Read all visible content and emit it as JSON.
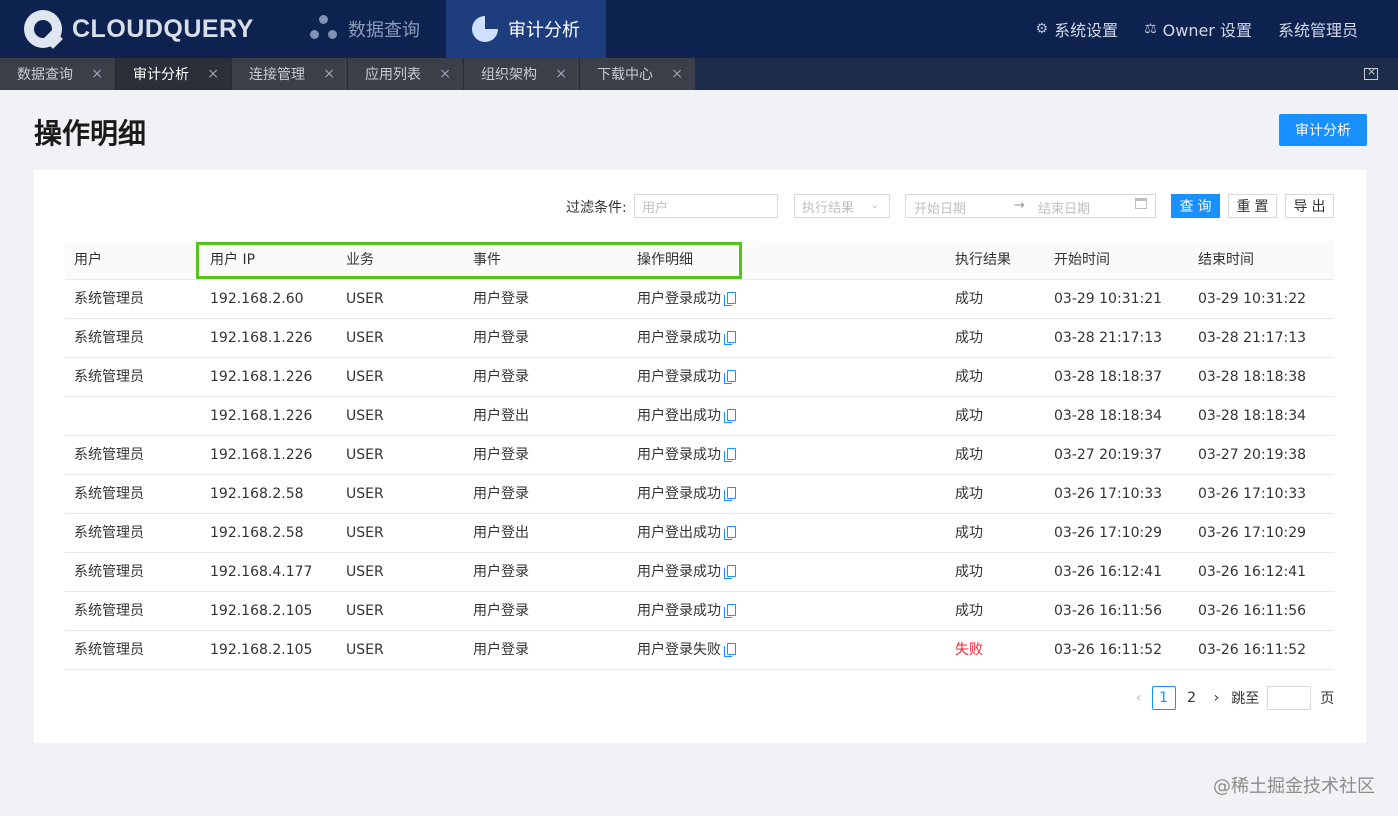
{
  "brand": {
    "logo_text": "CLOUDQUERY"
  },
  "top_nav": {
    "tabs": [
      {
        "label": "数据查询",
        "icon": "network-icon",
        "active": false
      },
      {
        "label": "审计分析",
        "icon": "pie-chart-icon",
        "active": true
      }
    ],
    "right": [
      {
        "label": "系统设置",
        "icon": "users-gear-icon"
      },
      {
        "label": "Owner 设置",
        "icon": "database-icon"
      },
      {
        "label": "系统管理员",
        "icon": ""
      }
    ]
  },
  "tab_strip": {
    "tabs": [
      {
        "label": "数据查询",
        "active": false
      },
      {
        "label": "审计分析",
        "active": true
      },
      {
        "label": "连接管理",
        "active": false
      },
      {
        "label": "应用列表",
        "active": false
      },
      {
        "label": "组织架构",
        "active": false
      },
      {
        "label": "下载中心",
        "active": false
      }
    ],
    "close_glyph": "×"
  },
  "page": {
    "title": "操作明细",
    "action_button": "审计分析"
  },
  "filters": {
    "label": "过滤条件:",
    "user_placeholder": "用户",
    "result_placeholder": "执行结果",
    "start_date_placeholder": "开始日期",
    "range_arrow": "→",
    "end_date_placeholder": "结束日期",
    "query_button": "查询",
    "reset_button": "重置",
    "export_button": "导出"
  },
  "table": {
    "columns": [
      "用户",
      "用户 IP",
      "业务",
      "事件",
      "操作明细",
      "执行结果",
      "开始时间",
      "结束时间"
    ],
    "rows": [
      {
        "user": "系统管理员",
        "ip": "192.168.2.60",
        "biz": "USER",
        "event": "用户登录",
        "detail": "用户登录成功",
        "result": "成功",
        "start": "03-29 10:31:21",
        "end": "03-29 10:31:22"
      },
      {
        "user": "系统管理员",
        "ip": "192.168.1.226",
        "biz": "USER",
        "event": "用户登录",
        "detail": "用户登录成功",
        "result": "成功",
        "start": "03-28 21:17:13",
        "end": "03-28 21:17:13"
      },
      {
        "user": "系统管理员",
        "ip": "192.168.1.226",
        "biz": "USER",
        "event": "用户登录",
        "detail": "用户登录成功",
        "result": "成功",
        "start": "03-28 18:18:37",
        "end": "03-28 18:18:38"
      },
      {
        "user": "",
        "ip": "192.168.1.226",
        "biz": "USER",
        "event": "用户登出",
        "detail": "用户登出成功",
        "result": "成功",
        "start": "03-28 18:18:34",
        "end": "03-28 18:18:34"
      },
      {
        "user": "系统管理员",
        "ip": "192.168.1.226",
        "biz": "USER",
        "event": "用户登录",
        "detail": "用户登录成功",
        "result": "成功",
        "start": "03-27 20:19:37",
        "end": "03-27 20:19:38"
      },
      {
        "user": "系统管理员",
        "ip": "192.168.2.58",
        "biz": "USER",
        "event": "用户登录",
        "detail": "用户登录成功",
        "result": "成功",
        "start": "03-26 17:10:33",
        "end": "03-26 17:10:33"
      },
      {
        "user": "系统管理员",
        "ip": "192.168.2.58",
        "biz": "USER",
        "event": "用户登出",
        "detail": "用户登出成功",
        "result": "成功",
        "start": "03-26 17:10:29",
        "end": "03-26 17:10:29"
      },
      {
        "user": "系统管理员",
        "ip": "192.168.4.177",
        "biz": "USER",
        "event": "用户登录",
        "detail": "用户登录成功",
        "result": "成功",
        "start": "03-26 16:12:41",
        "end": "03-26 16:12:41"
      },
      {
        "user": "系统管理员",
        "ip": "192.168.2.105",
        "biz": "USER",
        "event": "用户登录",
        "detail": "用户登录成功",
        "result": "成功",
        "start": "03-26 16:11:56",
        "end": "03-26 16:11:56"
      },
      {
        "user": "系统管理员",
        "ip": "192.168.2.105",
        "biz": "USER",
        "event": "用户登录",
        "detail": "用户登录失败",
        "result": "失败",
        "start": "03-26 16:11:52",
        "end": "03-26 16:11:52"
      }
    ]
  },
  "pagination": {
    "prev": "‹",
    "pages": [
      "1",
      "2"
    ],
    "current": "1",
    "next": "›",
    "jump_label": "跳至",
    "page_suffix": "页"
  },
  "watermark": "@稀土掘金技术社区",
  "colors": {
    "nav_bg": "#0e2250",
    "nav_active": "#1e3d7d",
    "primary": "#1890ff",
    "fail": "#f5222d",
    "highlight": "#52c41a"
  }
}
